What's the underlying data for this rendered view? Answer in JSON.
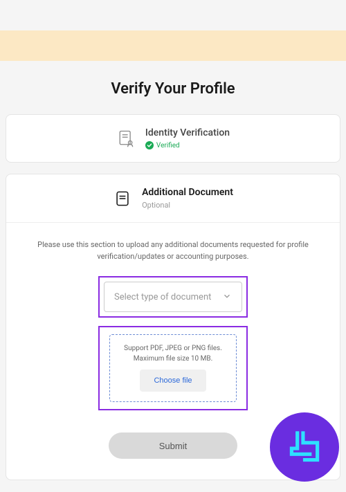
{
  "page": {
    "title": "Verify Your Profile"
  },
  "identity_card": {
    "title": "Identity Verification",
    "status": "Verified"
  },
  "additional_card": {
    "title": "Additional Document",
    "subtitle": "Optional",
    "instructions": "Please use this section to upload any additional documents requested for profile verification/updates or accounting purposes.",
    "select_placeholder": "Select type of document",
    "upload_hint_line1": "Support PDF, JPEG or PNG files.",
    "upload_hint_line2": "Maximum file size 10 MB.",
    "choose_label": "Choose file",
    "submit_label": "Submit"
  }
}
